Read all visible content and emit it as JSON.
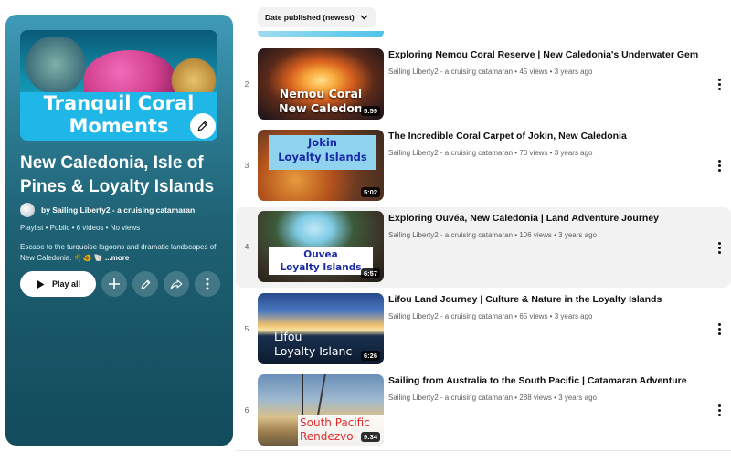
{
  "playlist": {
    "thumbnail_caption": [
      "Tranquil Coral",
      "Moments"
    ],
    "title": "New Caledonia, Isle of Pines & Loyalty Islands",
    "owner": "by Sailing Liberty2 - a cruising catamaran",
    "meta": "Playlist • Public • 6 videos • No views",
    "description": "Escape to the turquoise lagoons and dramatic landscapes of New Caledonia. 🌴🐠 🐚",
    "more_label": "...more",
    "play_all_label": "Play all",
    "colors": {
      "panel_top": "#3f9ab8",
      "panel_bottom": "#134c5c"
    }
  },
  "sort": {
    "label": "Date published (newest)"
  },
  "videos": [
    {
      "index": "2",
      "title": "Exploring Nemou Coral Reserve | New Caledonia's Underwater Gem",
      "channel": "Sailing Liberty2 - a cruising catamaran",
      "views": "45 views",
      "age": "3 years ago",
      "duration": "5:59",
      "thumb_caption": [
        "Nemou Coral",
        "New Caledon"
      ]
    },
    {
      "index": "3",
      "title": "The Incredible Coral Carpet of Jokin, New Caledonia",
      "channel": "Sailing Liberty2 - a cruising catamaran",
      "views": "70 views",
      "age": "3 years ago",
      "duration": "5:02",
      "thumb_caption": [
        "Jokin",
        "Loyalty Islands"
      ]
    },
    {
      "index": "4",
      "title": "Exploring Ouvéa, New Caledonia | Land Adventure Journey",
      "channel": "Sailing Liberty2 - a cruising catamaran",
      "views": "106 views",
      "age": "3 years ago",
      "duration": "6:57",
      "thumb_caption": [
        "Ouvea",
        "Loyalty Islands"
      ]
    },
    {
      "index": "5",
      "title": "Lifou Land Journey | Culture & Nature in the Loyalty Islands",
      "channel": "Sailing Liberty2 - a cruising catamaran",
      "views": "65 views",
      "age": "3 years ago",
      "duration": "6:26",
      "thumb_caption": [
        "Lifou",
        "Loyalty Islanc"
      ]
    },
    {
      "index": "6",
      "title": "Sailing from Australia to the South Pacific | Catamaran Adventure",
      "channel": "Sailing Liberty2 - a cruising catamaran",
      "views": "288 views",
      "age": "3 years ago",
      "duration": "9:34",
      "thumb_caption": [
        "South Pacific",
        "Rendezvo"
      ]
    }
  ]
}
